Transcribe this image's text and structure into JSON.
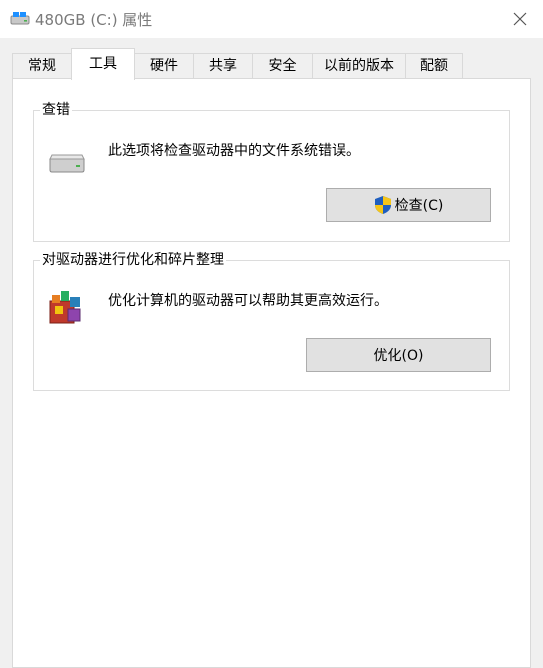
{
  "window": {
    "title": "480GB (C:) 属性",
    "close_label": "×"
  },
  "tabs": [
    {
      "label": "常规"
    },
    {
      "label": "工具"
    },
    {
      "label": "硬件"
    },
    {
      "label": "共享"
    },
    {
      "label": "安全"
    },
    {
      "label": "以前的版本"
    },
    {
      "label": "配额"
    }
  ],
  "active_tab": "工具",
  "error_check": {
    "title": "查错",
    "description": "此选项将检查驱动器中的文件系统错误。",
    "button_label": "检查(C)",
    "icon": "drive-icon"
  },
  "optimize": {
    "title": "对驱动器进行优化和碎片整理",
    "description": "优化计算机的驱动器可以帮助其更高效运行。",
    "button_label": "优化(O)",
    "icon": "defrag-icon"
  }
}
